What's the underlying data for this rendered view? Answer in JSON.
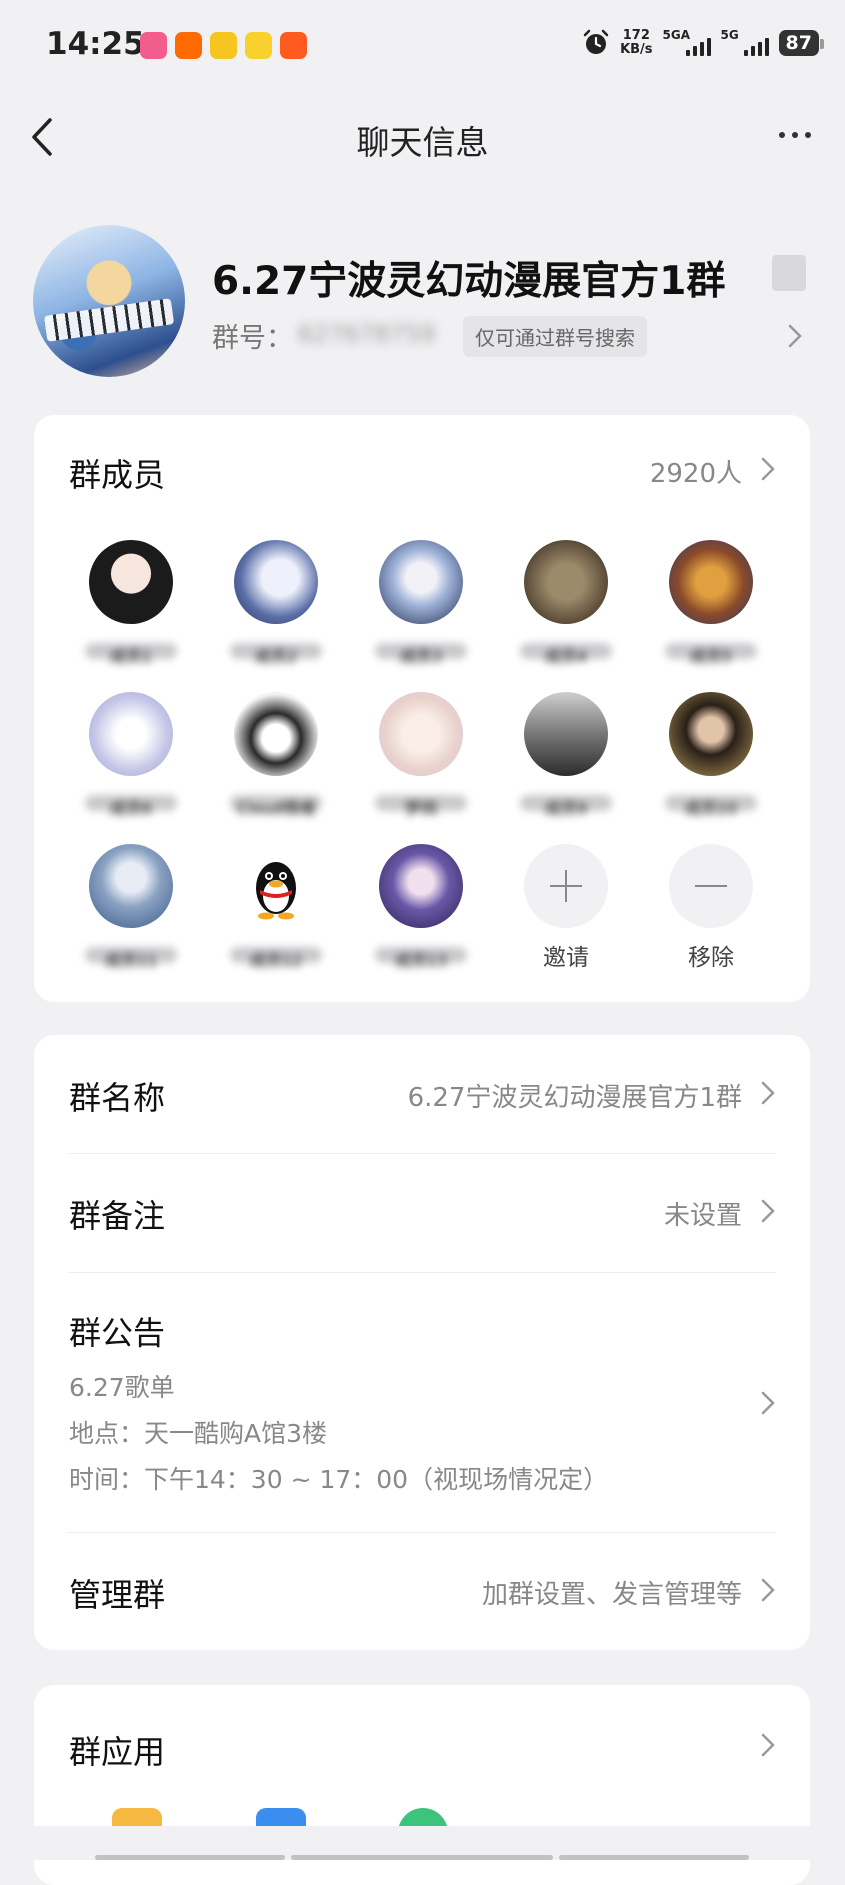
{
  "status_bar": {
    "time": "14:25",
    "network_speed_value": "172",
    "network_speed_unit": "KB/s",
    "sim1_label": "5GA",
    "sim2_label": "5G",
    "battery": "87",
    "app_icons": [
      "bilibili-icon",
      "taobao-icon",
      "meituan-icon",
      "ele-icon",
      "taobao-shop-icon"
    ],
    "app_icon_colors": [
      "#f25d8e",
      "#ff6a00",
      "#f7c520",
      "#f8d12f",
      "#ff5a1f"
    ]
  },
  "header": {
    "title": "聊天信息"
  },
  "group": {
    "name": "6.27宁波灵幻动漫展官方1群",
    "id_label": "群号：",
    "id_value": "627678759",
    "id_hint": "仅可通过群号搜索"
  },
  "members": {
    "label": "群成员",
    "count": "2920人",
    "items": [
      {
        "name": "成员1",
        "color": "#1b1b1b"
      },
      {
        "name": "成员2",
        "color": "#5a6fa8"
      },
      {
        "name": "成员3",
        "color": "#3a4f85"
      },
      {
        "name": "成员4",
        "color": "#7a6a52"
      },
      {
        "name": "成员5",
        "color": "#8a4a2a"
      },
      {
        "name": "成员6",
        "color": "#c7c8e8"
      },
      {
        "name": "Cloud情绪",
        "color": "#2a2a2a"
      },
      {
        "name": "梦鸽",
        "color": "#e9d2cc"
      },
      {
        "name": "成员9",
        "color": "#777"
      },
      {
        "name": "成员10",
        "color": "#5b4a2a"
      },
      {
        "name": "成员11",
        "color": "#4b6fa0"
      },
      {
        "name": "成员12",
        "color": "#ffffff"
      },
      {
        "name": "成员13",
        "color": "#4a3a7a"
      }
    ],
    "invite_label": "邀请",
    "remove_label": "移除"
  },
  "settings": {
    "group_name_label": "群名称",
    "group_name_value": "6.27宁波灵幻动漫展官方1群",
    "group_remark_label": "群备注",
    "group_remark_value": "未设置",
    "notice_label": "群公告",
    "notice_lines": [
      "6.27歌单",
      "地点：天一酷购A馆3楼",
      "时间：下午14：30 ~ 17：00（视现场情况定）"
    ],
    "manage_label": "管理群",
    "manage_value": "加群设置、发言管理等"
  },
  "apps": {
    "label": "群应用",
    "peek_colors": [
      "#f5b942",
      "#3b8ef0",
      "#3cc47c"
    ]
  }
}
